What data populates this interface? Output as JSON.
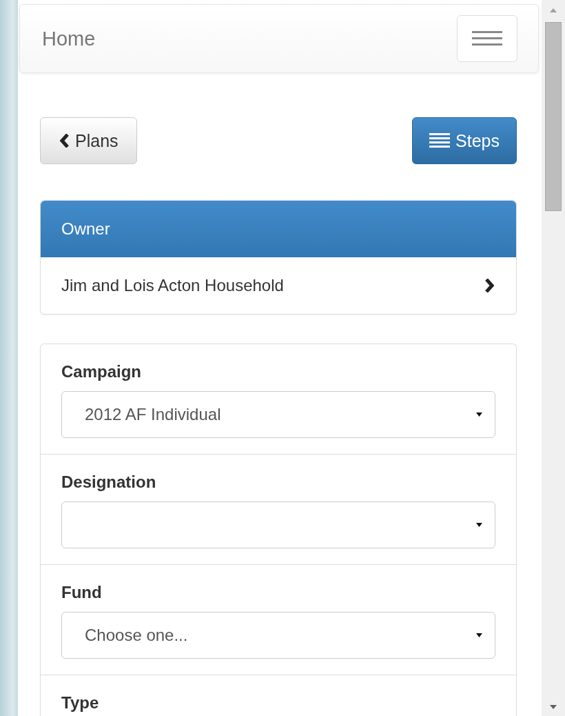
{
  "navbar": {
    "title": "Home"
  },
  "toolbar": {
    "back_button": "Plans",
    "steps_button": "Steps"
  },
  "owner_panel": {
    "heading": "Owner",
    "item": "Jim and Lois Acton Household"
  },
  "form": [
    {
      "label": "Campaign",
      "value": "2012 AF Individual"
    },
    {
      "label": "Designation"
    },
    {
      "label": "Fund",
      "value": "Choose one..."
    },
    {
      "label": "Type"
    }
  ]
}
